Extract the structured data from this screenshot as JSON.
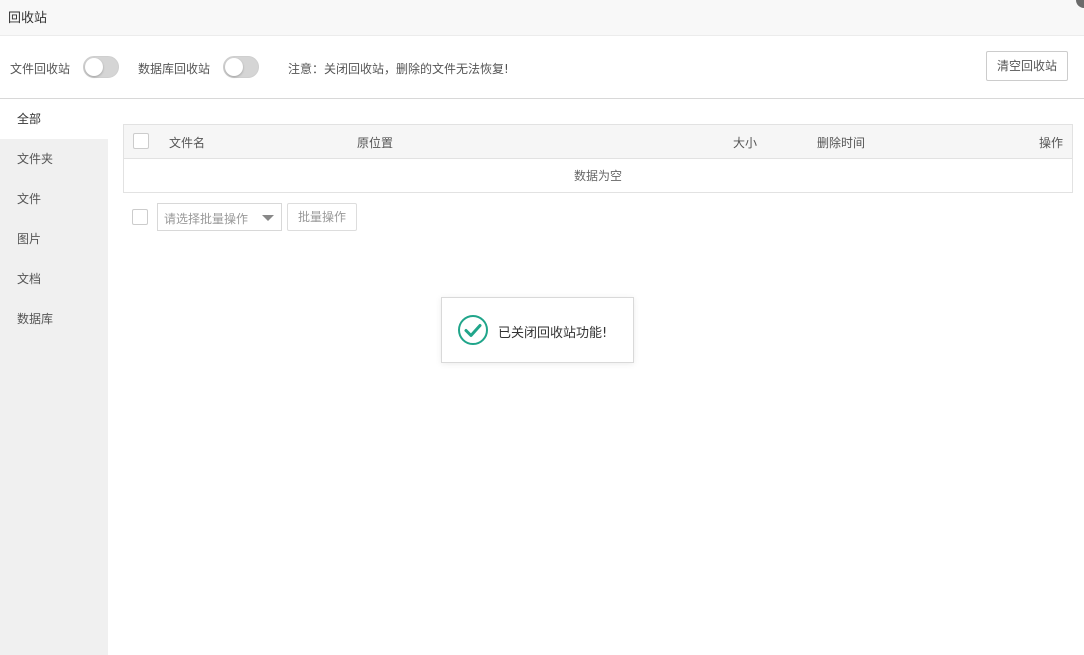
{
  "window": {
    "title": "回收站"
  },
  "toolbar": {
    "file_recycle_label": "文件回收站",
    "file_recycle_enabled": false,
    "db_recycle_label": "数据库回收站",
    "db_recycle_enabled": false,
    "notice": "注意：关闭回收站，删除的文件无法恢复!",
    "clear_button": "清空回收站"
  },
  "sidebar": {
    "items": [
      {
        "label": "全部",
        "active": true
      },
      {
        "label": "文件夹",
        "active": false
      },
      {
        "label": "文件",
        "active": false
      },
      {
        "label": "图片",
        "active": false
      },
      {
        "label": "文档",
        "active": false
      },
      {
        "label": "数据库",
        "active": false
      }
    ]
  },
  "table": {
    "columns": [
      "文件名",
      "原位置",
      "大小",
      "删除时间",
      "操作"
    ],
    "empty_text": "数据为空"
  },
  "batch": {
    "select_placeholder": "请选择批量操作",
    "button": "批量操作"
  },
  "toast": {
    "message": "已关闭回收站功能!",
    "icon": "check-circle-icon",
    "color": "#20a58a"
  }
}
